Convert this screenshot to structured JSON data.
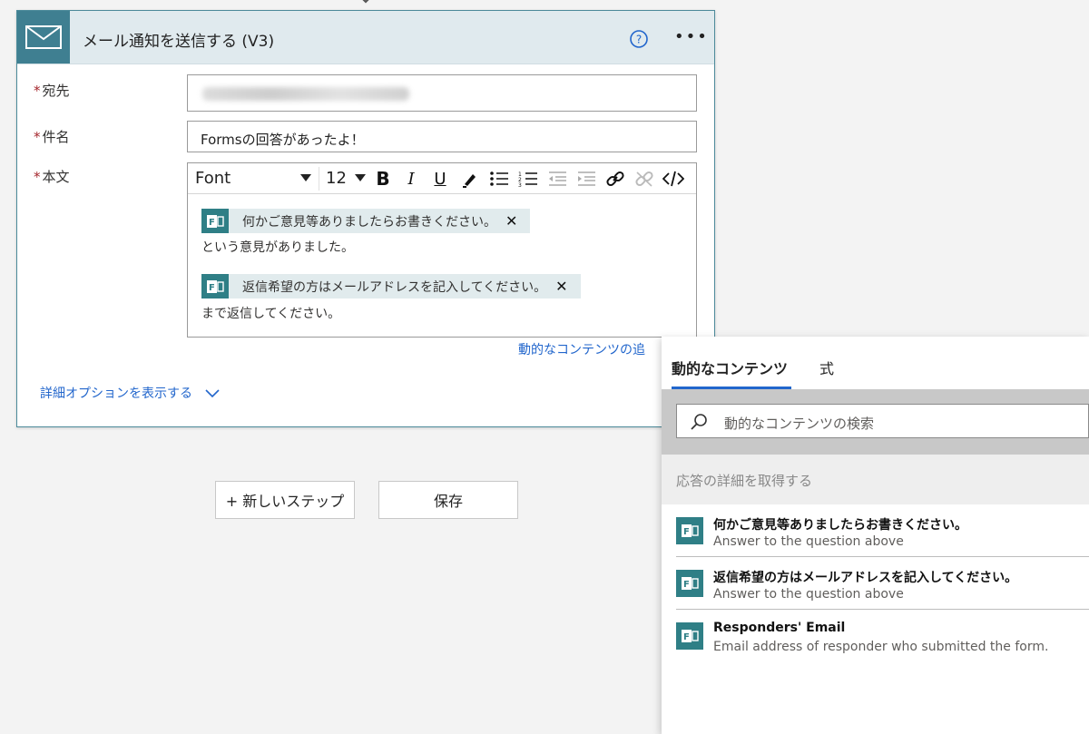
{
  "card": {
    "title": "メール通知を送信する (V3)",
    "fields": {
      "to_label": "宛先",
      "subject_label": "件名",
      "subject_value": "Formsの回答があったよ！",
      "body_label": "本文"
    },
    "toolbar": {
      "font": "Font",
      "size": "12"
    },
    "body": {
      "token1": "何かご意見等ありましたらお書きください。",
      "text1": "という意見がありました。",
      "token2": "返信希望の方はメールアドレスを記入してください。",
      "text2": "まで返信してください。"
    },
    "add_dynamic_link": "動的なコンテンツの追",
    "advanced_options": "詳細オプションを表示する"
  },
  "buttons": {
    "new_step": "+ 新しいステップ",
    "save": "保存"
  },
  "panel": {
    "tab_dynamic": "動的なコンテンツ",
    "tab_expression": "式",
    "search_placeholder": "動的なコンテンツの検索",
    "group_header": "応答の詳細を取得する",
    "items": [
      {
        "name": "何かご意見等ありましたらお書きください。",
        "desc": "Answer to the question above"
      },
      {
        "name": "返信希望の方はメールアドレスを記入してください。",
        "desc": "Answer to the question above"
      },
      {
        "name": "Responders' Email",
        "desc": "Email address of responder who submitted the form."
      }
    ]
  },
  "colors": {
    "accent": "#2266cc",
    "forms": "#2f7f86",
    "outlook": "#3f7f91",
    "required": "#a4262c"
  }
}
